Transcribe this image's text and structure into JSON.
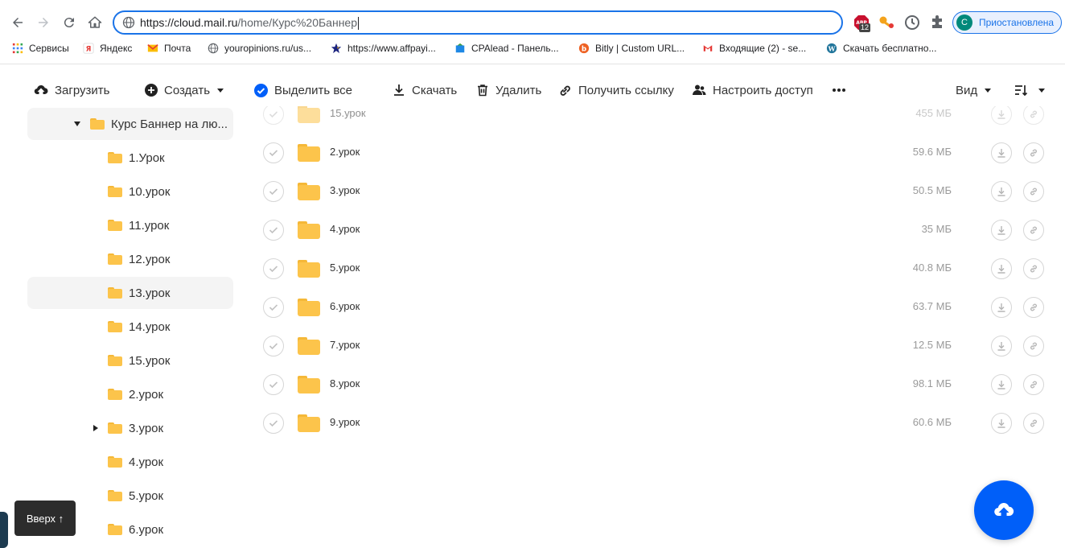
{
  "browser": {
    "url_host": "https://cloud.mail.ru",
    "url_path": "/home/Курс%20Баннер",
    "profile_initial": "С",
    "profile_label": "Приостановлена",
    "adblock_badge": "12",
    "accent": "#1a73e8"
  },
  "bookmarks": [
    {
      "label": "Сервисы",
      "icon": "apps-grid-icon"
    },
    {
      "label": "Яндекс",
      "icon": "yandex-icon"
    },
    {
      "label": "Почта",
      "icon": "mail-icon"
    },
    {
      "label": "youropinions.ru/us...",
      "icon": "globe-icon"
    },
    {
      "label": "https://www.affpayi...",
      "icon": "star-icon"
    },
    {
      "label": "CPAlead - Панель...",
      "icon": "cpalead-icon"
    },
    {
      "label": "Bitly | Custom URL...",
      "icon": "bitly-icon"
    },
    {
      "label": "Входящие (2) - se...",
      "icon": "gmail-icon"
    },
    {
      "label": "Скачать бесплатно...",
      "icon": "wordpress-icon"
    }
  ],
  "toolbar": {
    "upload": "Загрузить",
    "create": "Создать",
    "select_all": "Выделить все",
    "download": "Скачать",
    "delete": "Удалить",
    "get_link": "Получить ссылку",
    "access": "Настроить доступ",
    "view": "Вид"
  },
  "tree": {
    "root": "Курс Баннер на лю...",
    "items": [
      "1.Урок",
      "10.урок",
      "11.урок",
      "12.урок",
      "13.урок",
      "14.урок",
      "15.урок",
      "2.урок",
      "3.урок",
      "4.урок",
      "5.урок",
      "6.урок"
    ]
  },
  "files": [
    {
      "name": "15.урок",
      "size": "455 МБ"
    },
    {
      "name": "2.урок",
      "size": "59.6 МБ"
    },
    {
      "name": "3.урок",
      "size": "50.5 МБ"
    },
    {
      "name": "4.урок",
      "size": "35 МБ"
    },
    {
      "name": "5.урок",
      "size": "40.8 МБ"
    },
    {
      "name": "6.урок",
      "size": "63.7 МБ"
    },
    {
      "name": "7.урок",
      "size": "12.5 МБ"
    },
    {
      "name": "8.урок",
      "size": "98.1 МБ"
    },
    {
      "name": "9.урок",
      "size": "60.6 МБ"
    }
  ],
  "scroll_top": "Вверх ↑",
  "colors": {
    "folder": "#fcc44b",
    "fab": "#005ff9",
    "hover": "#f4f4f4"
  }
}
